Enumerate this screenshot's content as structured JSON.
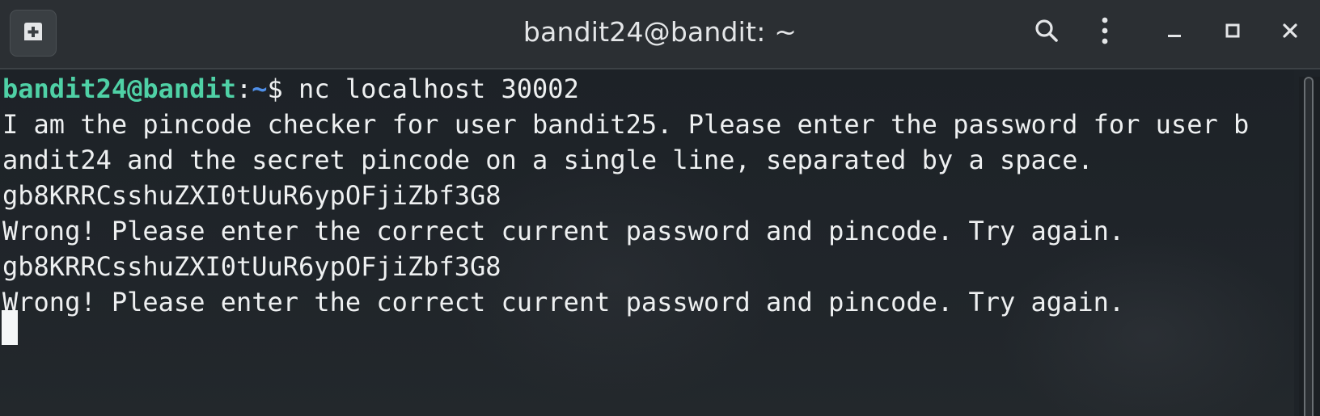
{
  "window": {
    "title": "bandit24@bandit: ~"
  },
  "titlebar": {
    "icons": {
      "new_tab": "new-tab-icon",
      "search": "search-icon",
      "menu": "kebab-menu-icon",
      "minimize": "minimize-icon",
      "maximize": "maximize-icon",
      "close": "close-icon"
    }
  },
  "terminal": {
    "prompt": {
      "user_host": "bandit24@bandit",
      "colon": ":",
      "dir": "~",
      "symbol": "$ ",
      "command": "nc localhost 30002"
    },
    "lines": [
      "I am the pincode checker for user bandit25. Please enter the password for user b",
      "andit24 and the secret pincode on a single line, separated by a space.",
      "gb8KRRCsshuZXI0tUuR6ypOFjiZbf3G8",
      "Wrong! Please enter the correct current password and pincode. Try again.",
      "gb8KRRCsshuZXI0tUuR6ypOFjiZbf3G8",
      "Wrong! Please enter the correct current password and pincode. Try again."
    ]
  },
  "colors": {
    "titlebar_bg": "#2b2f33",
    "terminal_bg": "#1e2328",
    "prompt_user": "#4fd1a6",
    "prompt_dir": "#4f8fe8",
    "text": "#eef0f1"
  }
}
